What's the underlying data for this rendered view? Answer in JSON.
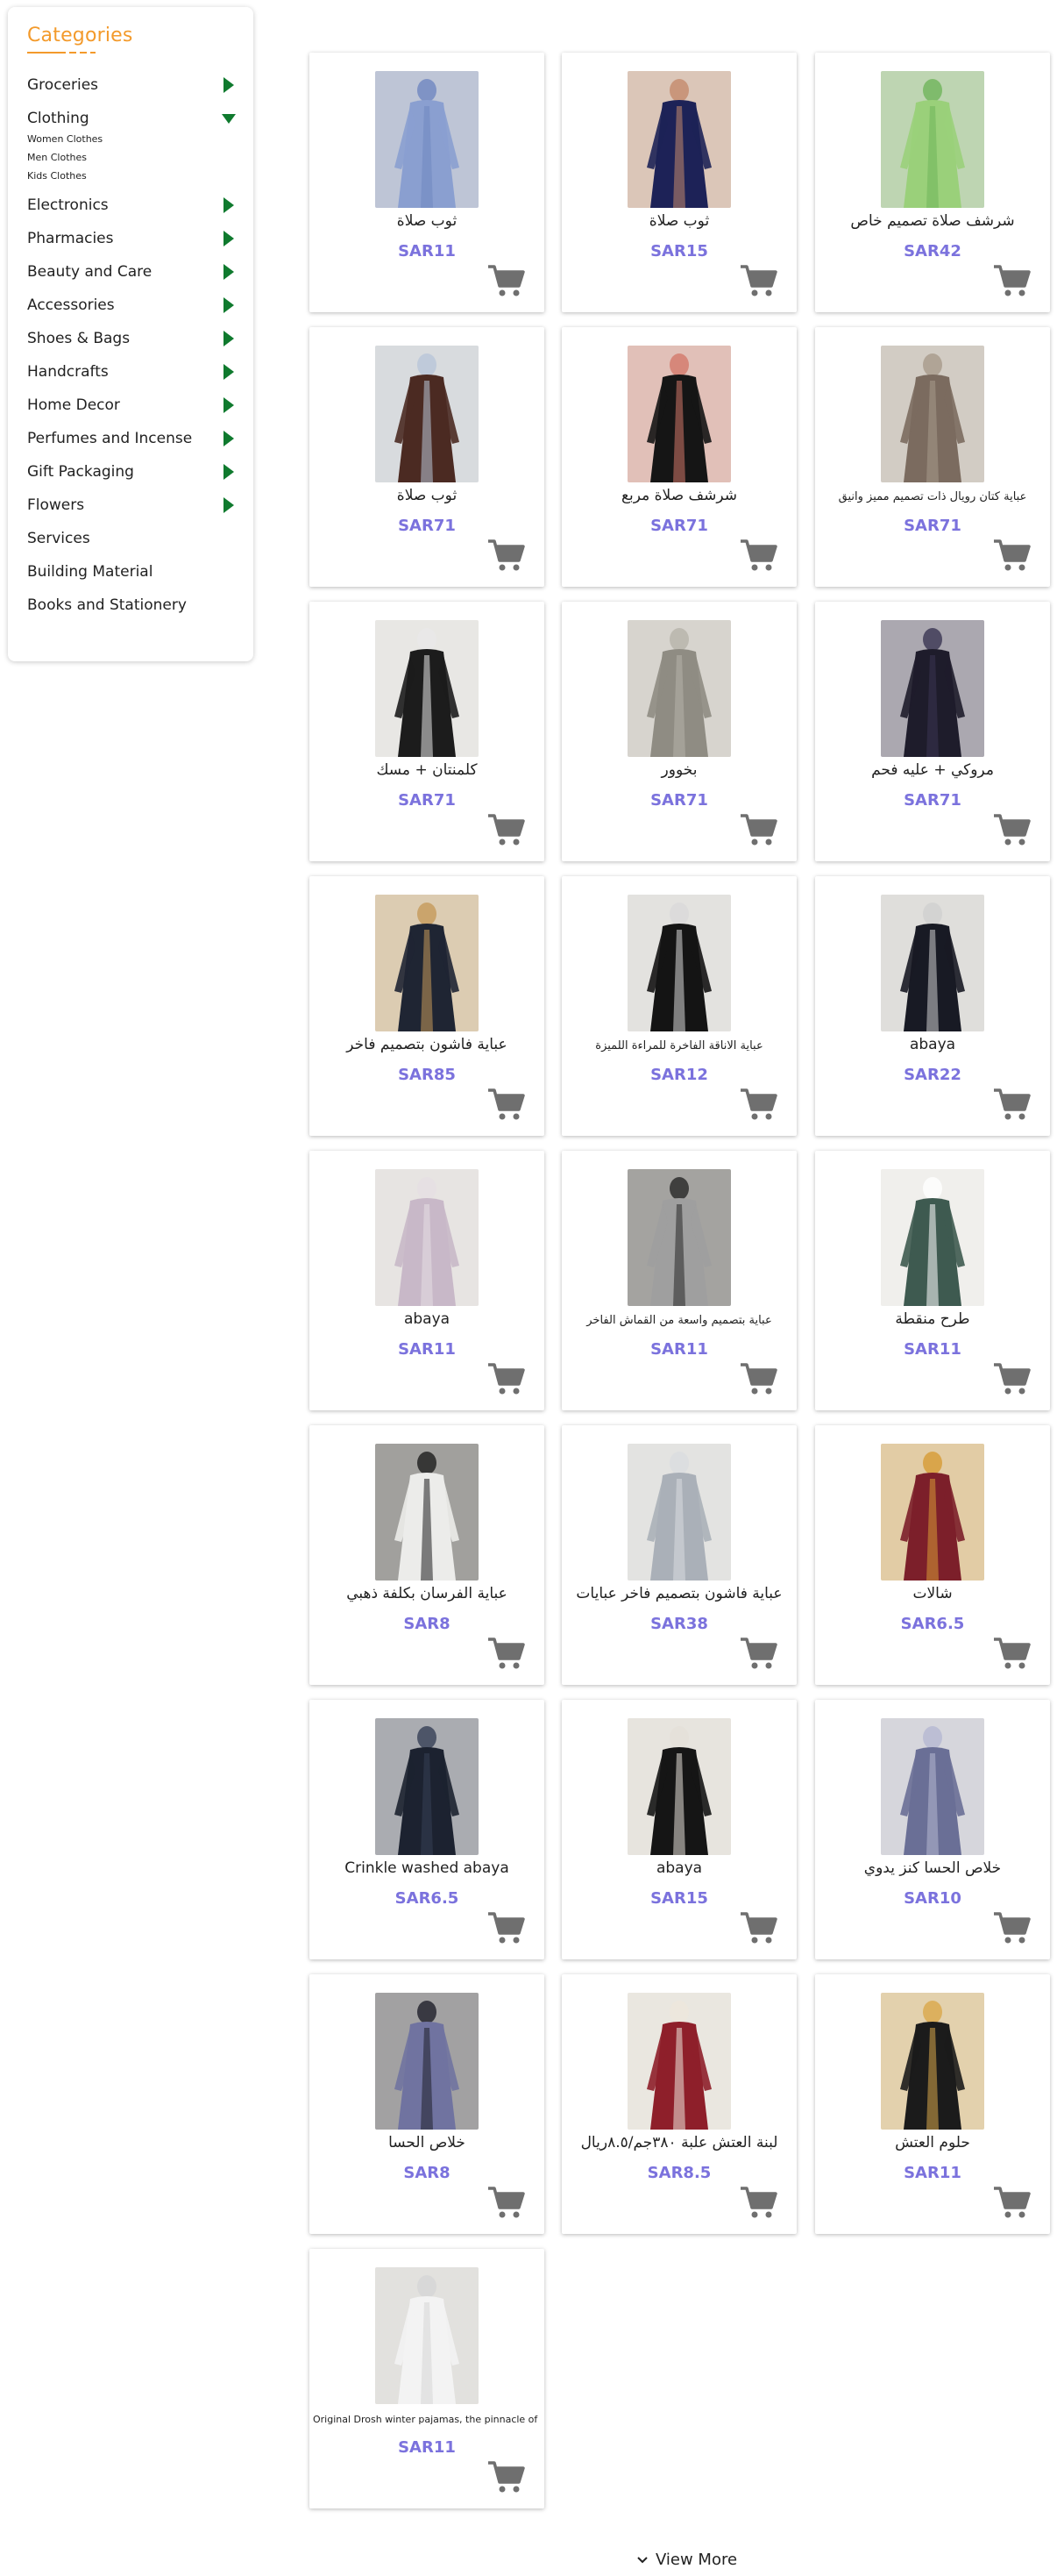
{
  "sidebar": {
    "title": "Categories",
    "accent_color": "#f39a2b",
    "arrow_color": "#0f7a2e",
    "items": [
      {
        "label": "Groceries",
        "arrow": "right"
      },
      {
        "label": "Clothing",
        "arrow": "down",
        "subitems": [
          "Women Clothes",
          "Men Clothes",
          "Kids Clothes"
        ]
      },
      {
        "label": "Electronics",
        "arrow": "right"
      },
      {
        "label": "Pharmacies",
        "arrow": "right"
      },
      {
        "label": "Beauty and Care",
        "arrow": "right"
      },
      {
        "label": "Accessories",
        "arrow": "right"
      },
      {
        "label": "Shoes & Bags",
        "arrow": "right"
      },
      {
        "label": "Handcrafts",
        "arrow": "right"
      },
      {
        "label": "Home Decor",
        "arrow": "right"
      },
      {
        "label": "Perfumes and Incense",
        "arrow": "right"
      },
      {
        "label": "Gift Packaging",
        "arrow": "right"
      },
      {
        "label": "Flowers",
        "arrow": "right"
      },
      {
        "label": "Services",
        "arrow": "none"
      },
      {
        "label": "Building Material",
        "arrow": "none"
      },
      {
        "label": "Books and Stationery",
        "arrow": "none"
      }
    ]
  },
  "price_color": "#7b72dd",
  "cart_icon": "shopping-cart-icon",
  "products": [
    {
      "name": "ثوب صلاة",
      "price": "SAR11",
      "colors": [
        "#8a9fd0",
        "#6f86c0"
      ]
    },
    {
      "name": "ثوب صلاة",
      "price": "SAR15",
      "colors": [
        "#1d2257",
        "#c48a6b"
      ]
    },
    {
      "name": "شرشف صلاة تصميم خاص",
      "price": "SAR42",
      "colors": [
        "#9ad07a",
        "#6fb45a"
      ]
    },
    {
      "name": "ثوب صلاة",
      "price": "SAR71",
      "colors": [
        "#4b2a22",
        "#b9c6d8"
      ]
    },
    {
      "name": "شرشف صلاة مربع",
      "price": "SAR71",
      "colors": [
        "#151515",
        "#d3786a"
      ]
    },
    {
      "name": "عباية كتان رويال ذات تصميم مميز وانيق",
      "price": "SAR71",
      "colors": [
        "#7b6b5f",
        "#a89a8b"
      ]
    },
    {
      "name": "كلمنتان + مسك",
      "price": "SAR71",
      "colors": [
        "#1c1c1c",
        "#e8e8e8"
      ]
    },
    {
      "name": "بخوور",
      "price": "SAR71",
      "colors": [
        "#8f8c83",
        "#b7b3aa"
      ]
    },
    {
      "name": "مروكي + عليه فحم",
      "price": "SAR71",
      "colors": [
        "#1e1c2b",
        "#3a3552"
      ]
    },
    {
      "name": "عباية فاشون بتصميم فاخر",
      "price": "SAR85",
      "colors": [
        "#1f2533",
        "#c69a5a"
      ]
    },
    {
      "name": "عباية الاناقة الفاخرة للمراءة اللميزة",
      "price": "SAR12",
      "colors": [
        "#141414",
        "#d9d9d9"
      ]
    },
    {
      "name": "abaya",
      "price": "SAR22",
      "colors": [
        "#181a24",
        "#cfcfcf"
      ]
    },
    {
      "name": "abaya",
      "price": "SAR11",
      "colors": [
        "#c8b8c8",
        "#e6dfe3"
      ]
    },
    {
      "name": "عباية بتصميم واسعة من القماش الفاخر",
      "price": "SAR11",
      "colors": [
        "#9f9f9f",
        "#262626"
      ]
    },
    {
      "name": "طرح منقطة",
      "price": "SAR11",
      "colors": [
        "#3e5a50",
        "#ffffff"
      ]
    },
    {
      "name": "عباية الفرسان بكلفة ذهبي",
      "price": "SAR8",
      "colors": [
        "#ececea",
        "#1d1d1d"
      ]
    },
    {
      "name": "عباية فاشون بتصميم فاخر عبايات",
      "price": "SAR38",
      "colors": [
        "#aab0b8",
        "#d9dce0"
      ]
    },
    {
      "name": "شالات",
      "price": "SAR6.5",
      "colors": [
        "#7c1f2a",
        "#d79b35"
      ]
    },
    {
      "name": "Crinkle washed abaya",
      "price": "SAR6.5",
      "colors": [
        "#1c2230",
        "#364056"
      ]
    },
    {
      "name": "abaya",
      "price": "SAR15",
      "colors": [
        "#151515",
        "#e5e0d8"
      ]
    },
    {
      "name": "خلاص الحسا كنز يدوي",
      "price": "SAR10",
      "colors": [
        "#6a6f96",
        "#b5b8d2"
      ]
    },
    {
      "name": "خلاص الحسا",
      "price": "SAR8",
      "colors": [
        "#7073a0",
        "#1f1f2a"
      ]
    },
    {
      "name": "لبنة العتش علبة ٣٨٠جم/٨.٥ريال",
      "price": "SAR8.5",
      "colors": [
        "#8e1f2a",
        "#ede7dc"
      ]
    },
    {
      "name": "حلوم العتش",
      "price": "SAR11",
      "colors": [
        "#1b1b1b",
        "#d9a84a"
      ]
    },
    {
      "name": "Original Drosh winter pajamas, the pinnacle of luxury",
      "price": "SAR11",
      "colors": [
        "#f3f3f3",
        "#d6d6d6"
      ]
    }
  ],
  "view_more": {
    "label": "View More"
  }
}
